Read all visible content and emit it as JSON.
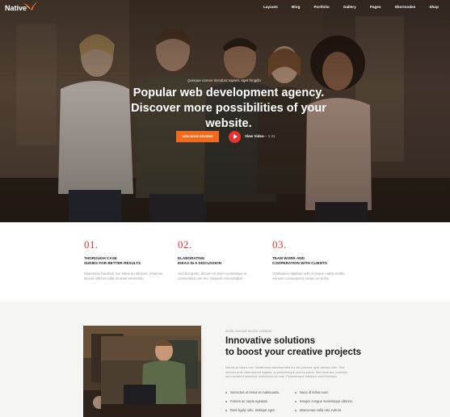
{
  "nav": {
    "logo": "Native",
    "items": [
      "Layouts",
      "Blog",
      "Portfolio",
      "Gallery",
      "Pages",
      "Shortcodes",
      "Shop"
    ]
  },
  "hero": {
    "kicker": "Quisque comue tincidunt sapien, eget fringilla",
    "title_line1": "Popular web development agency.",
    "title_line2": "Discover more possibilities of your website.",
    "reviews_button": "VIEW MORE REVIEWS",
    "video_label": "View Video",
    "video_time": "— 1:41"
  },
  "features": [
    {
      "number": "01.",
      "title_line1": "THOROUGH CASE",
      "title_line2": "SUDIES FOR BETTER RESULTS",
      "text_line1": "Maecenas faucibus non tellus eu ultricies. Vivamus",
      "text_line2": "lacinia ultrices nulla sit amet venenatis."
    },
    {
      "number": "02.",
      "title_line1": "ELABORATING",
      "title_line2": "IDEAS IN A DISCUSSION",
      "text_line1": "Sed dui quam, dictum sit amet scelerisque in,",
      "text_line2": "consectetur non leo. Aliquam erat volutpat."
    },
    {
      "number": "03.",
      "title_line1": "TEAM WORK AND",
      "title_line2": "COOPERATION WITH CLIENTS",
      "text_line1": "Vestibulum dapibus velit ut neque mattis mattis.",
      "text_line2": "Aenean consequat a neque eu porta."
    }
  ],
  "lower": {
    "kicker": "Nulla suscipit lacinia volutpat",
    "title_line1": "Innovative solutions",
    "title_line2": "to boost your creative projects",
    "para_line1": "Mauris at varius orci. Vestibulum interdum felis eu nisl pulvinar, quis ultrices nibh. Sed",
    "para_line2": "ultricies ante vitae laoreet sagittis. In pellentesque viverra purus. Sed risus est, molestie",
    "para_line3": "nec hendrerit hendrerit, sollicitudin ac ante. Pellentesque habitant morbi tristique.",
    "bullets": [
      "Senectus et netus et malesuada.",
      "Nunc id tellus nunc.",
      "Fames ac turpis egestas.",
      "Integer congue scelerisque ultrices.",
      "Duis ligula odio, tristique eget.",
      "Maecenas nulla nisi, rutrum."
    ]
  },
  "colors": {
    "accent_orange": "#f26b1d",
    "accent_red": "#e8322b",
    "hero_dark": "#4a3a2e",
    "section_gray": "#f5f5f4"
  }
}
